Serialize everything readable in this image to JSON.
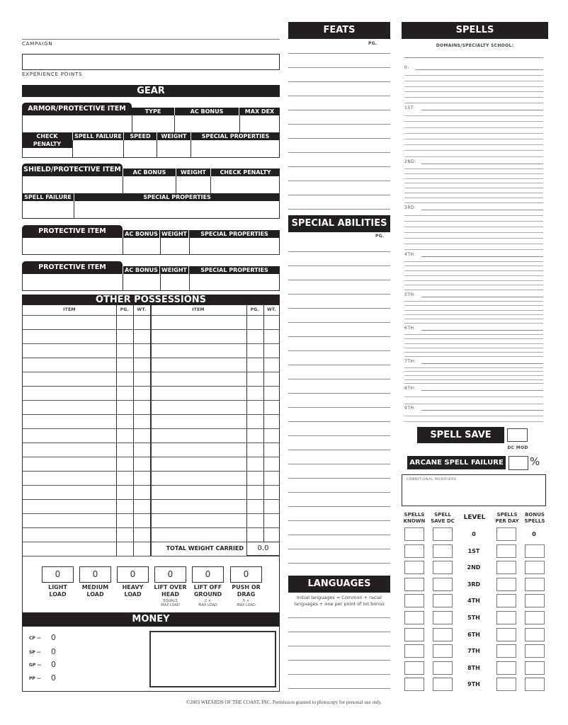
{
  "header": {
    "campaign_label": "CAMPAIGN",
    "experience_label": "EXPERIENCE POINTS",
    "campaign_value": "",
    "experience_value": ""
  },
  "gear": {
    "title": "GEAR",
    "armor": {
      "title": "ARMOR/PROTECTIVE ITEM",
      "type": "TYPE",
      "ac_bonus": "AC BONUS",
      "max_dex": "MAX DEX",
      "check_penalty": "CHECK PENALTY",
      "spell_failure": "SPELL FAILURE",
      "speed": "SPEED",
      "weight": "WEIGHT",
      "special_properties": "SPECIAL PROPERTIES"
    },
    "shield": {
      "title": "SHIELD/PROTECTIVE ITEM",
      "ac_bonus": "AC BONUS",
      "weight": "WEIGHT",
      "check_penalty": "CHECK PENALTY",
      "spell_failure": "SPELL FAILURE",
      "special_properties": "SPECIAL PROPERTIES"
    },
    "protective_items": [
      {
        "title": "PROTECTIVE ITEM",
        "ac_bonus": "AC BONUS",
        "weight": "WEIGHT",
        "special_properties": "SPECIAL PROPERTIES"
      },
      {
        "title": "PROTECTIVE ITEM",
        "ac_bonus": "AC BONUS",
        "weight": "WEIGHT",
        "special_properties": "SPECIAL PROPERTIES"
      }
    ]
  },
  "possessions": {
    "title": "OTHER POSSESSIONS",
    "col_item": "ITEM",
    "col_pg": "PG.",
    "col_wt": "WT.",
    "row_count": 17,
    "total_weight_label": "TOTAL WEIGHT CARRIED",
    "total_weight_value": "0.0"
  },
  "loads": [
    {
      "value": "0",
      "label1": "LIGHT",
      "label2": "LOAD",
      "note1": "",
      "note2": ""
    },
    {
      "value": "0",
      "label1": "MEDIUM",
      "label2": "LOAD",
      "note1": "",
      "note2": ""
    },
    {
      "value": "0",
      "label1": "HEAVY",
      "label2": "LOAD",
      "note1": "",
      "note2": ""
    },
    {
      "value": "0",
      "label1": "LIFT OVER",
      "label2": "HEAD",
      "note1": "EQUALS",
      "note2": "MAX LOAD"
    },
    {
      "value": "0",
      "label1": "LIFT OFF",
      "label2": "GROUND",
      "note1": "2 ×",
      "note2": "MAX LOAD"
    },
    {
      "value": "0",
      "label1": "PUSH OR",
      "label2": "DRAG",
      "note1": "5 ×",
      "note2": "MAX LOAD"
    }
  ],
  "money": {
    "title": "MONEY",
    "coins": [
      {
        "label": "CP —",
        "value": "0"
      },
      {
        "label": "SP —",
        "value": "0"
      },
      {
        "label": "GP —",
        "value": "0"
      },
      {
        "label": "PP —",
        "value": "0"
      }
    ]
  },
  "feats": {
    "title": "FEATS",
    "pg_label": "PG."
  },
  "special_abilities": {
    "title": "SPECIAL ABILITIES",
    "pg_label": "PG."
  },
  "languages": {
    "title": "LANGUAGES",
    "note_line1": "Initial languages = Common + racial",
    "note_line2": "languages + one per point of Int bonus"
  },
  "spells": {
    "title": "SPELLS",
    "domains_label": "DOMAINS/SPECIALTY SCHOOL:",
    "level_labels": [
      "0:",
      "1ST:",
      "2ND:",
      "3RD:",
      "4TH:",
      "5TH:",
      "6TH:",
      "7TH:",
      "8TH:",
      "9TH:"
    ],
    "spell_save_label": "SPELL SAVE",
    "dc_mod_label": "DC MOD",
    "arcane_failure_label": "ARCANE SPELL FAILURE",
    "percent_sign": "%",
    "conditional_modifiers_label": "CONDITIONAL MODIFIERS",
    "table": {
      "col_known": [
        "SPELLS",
        "KNOWN"
      ],
      "col_save_dc": [
        "SPELL",
        "SAVE DC"
      ],
      "col_level": "LEVEL",
      "col_per_day": [
        "SPELLS",
        "PER DAY"
      ],
      "col_bonus": [
        "BONUS",
        "SPELLS"
      ],
      "levels": [
        "0",
        "1ST",
        "2ND",
        "3RD",
        "4TH",
        "5TH",
        "6TH",
        "7TH",
        "8TH",
        "9TH"
      ],
      "bonus_level0": "0"
    }
  },
  "footer": {
    "copyright": "©2003 WIZARDS OF THE COAST, INC. Permission granted to photocopy for personal use only."
  }
}
